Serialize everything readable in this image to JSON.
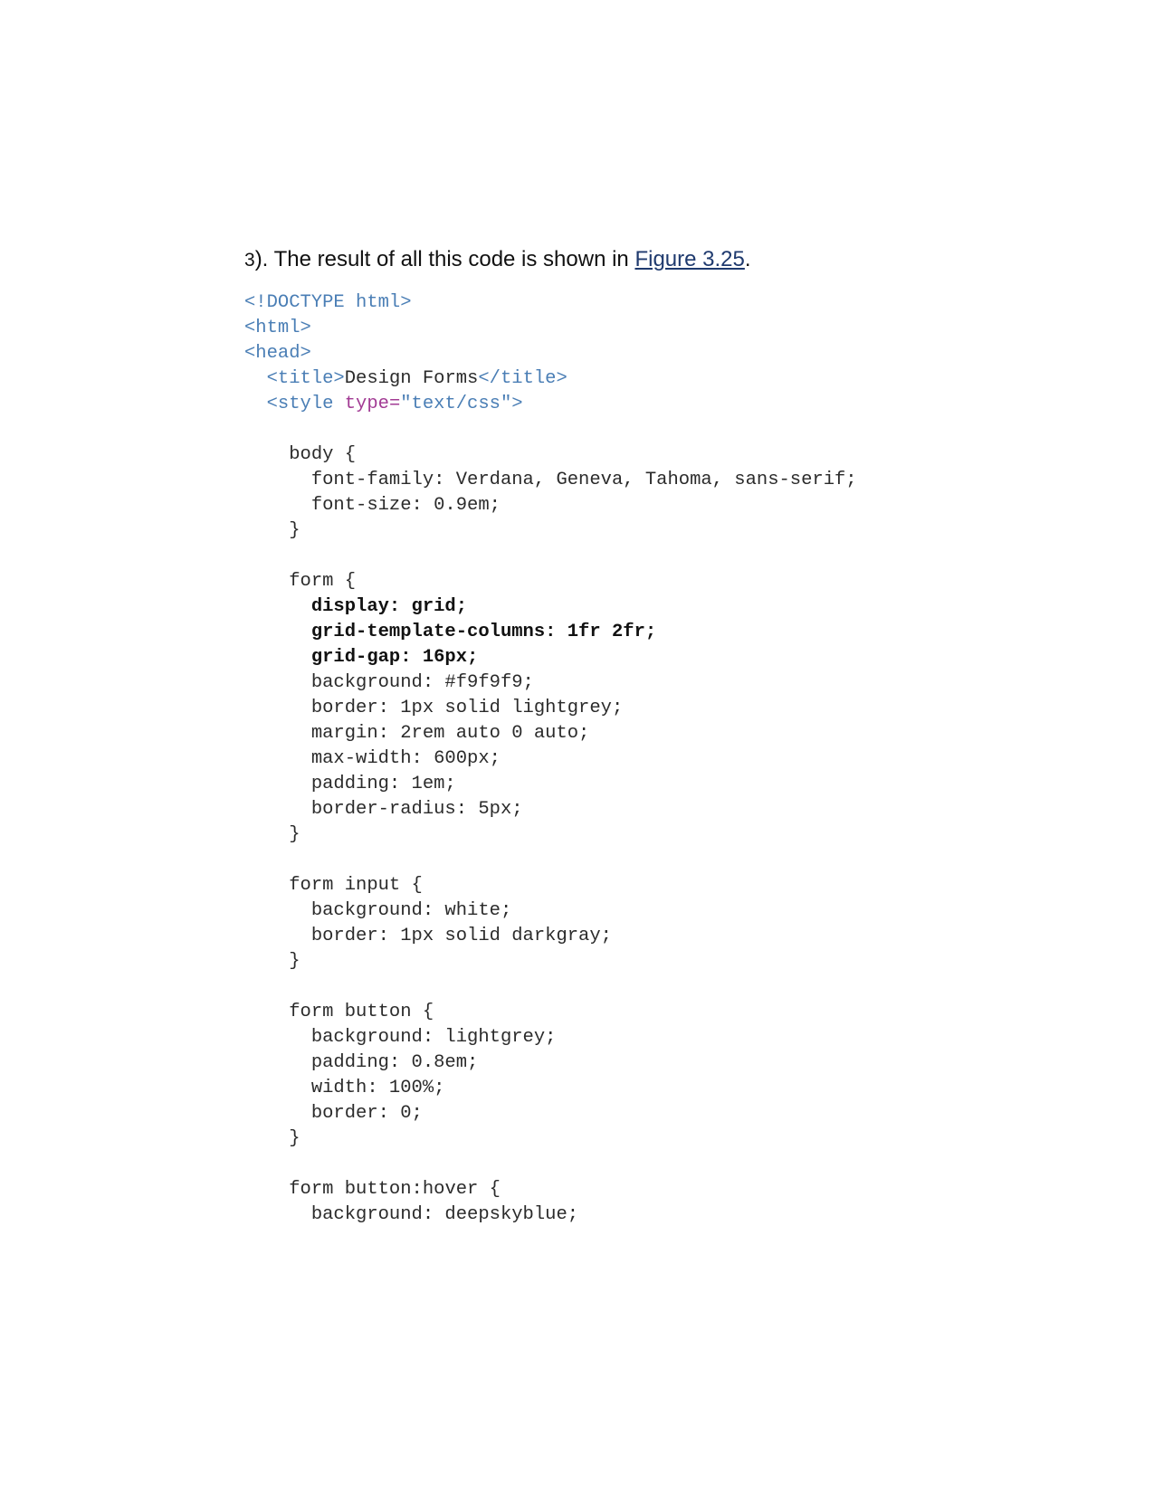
{
  "intro": {
    "number": "3",
    "text_before": "). The result of all this code is shown in ",
    "link_text": "Figure 3.25",
    "text_after": "."
  },
  "code_lines": [
    {
      "indent": "",
      "parts": [
        {
          "t": "<!DOCTYPE html>",
          "c": "tag"
        }
      ]
    },
    {
      "indent": "",
      "parts": [
        {
          "t": "<html>",
          "c": "tag"
        }
      ]
    },
    {
      "indent": "",
      "parts": [
        {
          "t": "<head>",
          "c": "tag"
        }
      ]
    },
    {
      "indent": "  ",
      "parts": [
        {
          "t": "<title>",
          "c": "tag"
        },
        {
          "t": "Design Forms",
          "c": ""
        },
        {
          "t": "</title>",
          "c": "tag"
        }
      ]
    },
    {
      "indent": "  ",
      "parts": [
        {
          "t": "<style ",
          "c": "tag"
        },
        {
          "t": "type=",
          "c": "attr"
        },
        {
          "t": "\"text/css\">",
          "c": "val"
        }
      ]
    },
    {
      "indent": "",
      "parts": []
    },
    {
      "indent": "    ",
      "parts": [
        {
          "t": "body {",
          "c": ""
        }
      ]
    },
    {
      "indent": "      ",
      "parts": [
        {
          "t": "font-family: Verdana, Geneva, Tahoma, sans-serif;",
          "c": ""
        }
      ]
    },
    {
      "indent": "      ",
      "parts": [
        {
          "t": "font-size: 0.9em;",
          "c": ""
        }
      ]
    },
    {
      "indent": "    ",
      "parts": [
        {
          "t": "}",
          "c": ""
        }
      ]
    },
    {
      "indent": "",
      "parts": []
    },
    {
      "indent": "    ",
      "parts": [
        {
          "t": "form {",
          "c": ""
        }
      ]
    },
    {
      "indent": "      ",
      "parts": [
        {
          "t": "display: grid;",
          "c": "bold"
        }
      ]
    },
    {
      "indent": "      ",
      "parts": [
        {
          "t": "grid-template-columns: 1fr 2fr;",
          "c": "bold"
        }
      ]
    },
    {
      "indent": "      ",
      "parts": [
        {
          "t": "grid-gap: 16px;",
          "c": "bold"
        }
      ]
    },
    {
      "indent": "      ",
      "parts": [
        {
          "t": "background: #f9f9f9;",
          "c": ""
        }
      ]
    },
    {
      "indent": "      ",
      "parts": [
        {
          "t": "border: 1px solid lightgrey;",
          "c": ""
        }
      ]
    },
    {
      "indent": "      ",
      "parts": [
        {
          "t": "margin: 2rem auto 0 auto;",
          "c": ""
        }
      ]
    },
    {
      "indent": "      ",
      "parts": [
        {
          "t": "max-width: 600px;",
          "c": ""
        }
      ]
    },
    {
      "indent": "      ",
      "parts": [
        {
          "t": "padding: 1em;",
          "c": ""
        }
      ]
    },
    {
      "indent": "      ",
      "parts": [
        {
          "t": "border-radius: 5px;",
          "c": ""
        }
      ]
    },
    {
      "indent": "    ",
      "parts": [
        {
          "t": "}",
          "c": ""
        }
      ]
    },
    {
      "indent": "",
      "parts": []
    },
    {
      "indent": "    ",
      "parts": [
        {
          "t": "form input {",
          "c": ""
        }
      ]
    },
    {
      "indent": "      ",
      "parts": [
        {
          "t": "background: white;",
          "c": ""
        }
      ]
    },
    {
      "indent": "      ",
      "parts": [
        {
          "t": "border: 1px solid darkgray;",
          "c": ""
        }
      ]
    },
    {
      "indent": "    ",
      "parts": [
        {
          "t": "}",
          "c": ""
        }
      ]
    },
    {
      "indent": "",
      "parts": []
    },
    {
      "indent": "    ",
      "parts": [
        {
          "t": "form button {",
          "c": ""
        }
      ]
    },
    {
      "indent": "      ",
      "parts": [
        {
          "t": "background: lightgrey;",
          "c": ""
        }
      ]
    },
    {
      "indent": "      ",
      "parts": [
        {
          "t": "padding: 0.8em;",
          "c": ""
        }
      ]
    },
    {
      "indent": "      ",
      "parts": [
        {
          "t": "width: 100%;",
          "c": ""
        }
      ]
    },
    {
      "indent": "      ",
      "parts": [
        {
          "t": "border: 0;",
          "c": ""
        }
      ]
    },
    {
      "indent": "    ",
      "parts": [
        {
          "t": "}",
          "c": ""
        }
      ]
    },
    {
      "indent": "",
      "parts": []
    },
    {
      "indent": "    ",
      "parts": [
        {
          "t": "form button:hover {",
          "c": ""
        }
      ]
    },
    {
      "indent": "      ",
      "parts": [
        {
          "t": "background: deepskyblue;",
          "c": ""
        }
      ]
    }
  ]
}
